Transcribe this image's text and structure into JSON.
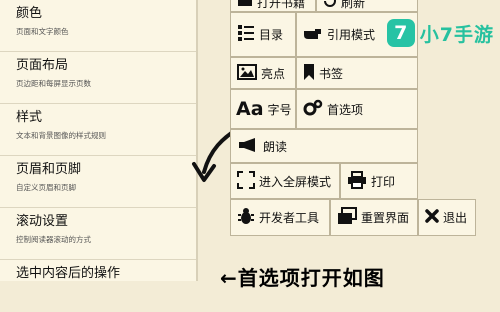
{
  "settings": [
    {
      "title": "颜色",
      "desc": "页面和文字颜色"
    },
    {
      "title": "页面布局",
      "desc": "页边距和每屏显示页数"
    },
    {
      "title": "样式",
      "desc": "文本和背景图像的样式规则"
    },
    {
      "title": "页眉和页脚",
      "desc": "自定义页眉和页脚"
    },
    {
      "title": "滚动设置",
      "desc": "控制阅读器滚动的方式"
    },
    {
      "title": "选中内容后的操作",
      "desc": ""
    }
  ],
  "menu": {
    "open_book": "打开书籍",
    "refresh": "刷新",
    "toc": "目录",
    "reference_mode": "引用模式",
    "brightness": "亮点",
    "bookmark": "书签",
    "font_aa": "Aa",
    "font_size": "字号",
    "preferences": "首选项",
    "read_aloud": "朗读",
    "fullscreen": "进入全屏模式",
    "print": "打印",
    "devtools": "开发者工具",
    "reset_layout": "重置界面",
    "exit": "退出"
  },
  "logo": {
    "mark": "7",
    "text": "小7手游"
  },
  "caption": "←首选项打开如图"
}
